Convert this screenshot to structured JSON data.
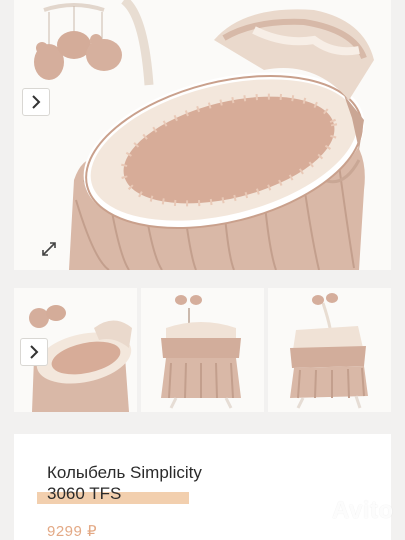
{
  "listing": {
    "title_line1": "Колыбель Simplicity",
    "title_line2": "3060 TFS",
    "price": "9299 ₽"
  },
  "gallery": {
    "main_image": "bassinet-photo",
    "thumbnails": [
      "bassinet-angle",
      "bassinet-front",
      "bassinet-side"
    ]
  },
  "icons": {
    "next": "chevron-right-icon",
    "expand": "expand-icon"
  },
  "watermark": {
    "text": "Avito"
  },
  "colors": {
    "fabric": "#d8b7a6",
    "price": "#e3a985",
    "highlight": "#f2cfae"
  }
}
